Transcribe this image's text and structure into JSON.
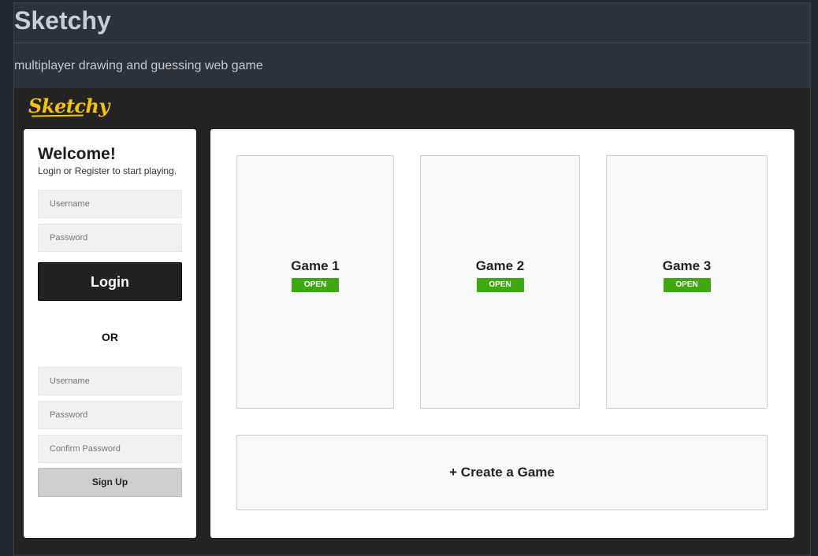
{
  "readme": {
    "title": "Sketchy",
    "description": "multiplayer drawing and guessing web game"
  },
  "app": {
    "logo_text": "Sketchy",
    "colors": {
      "accent": "#f5c400",
      "open_badge": "#3ea812",
      "dark": "#232323"
    }
  },
  "login": {
    "heading": "Welcome!",
    "subheading": "Login or Register to start playing.",
    "username_placeholder": "Username",
    "password_placeholder": "Password",
    "login_button": "Login"
  },
  "divider": "OR",
  "register": {
    "username_placeholder": "Username",
    "password_placeholder": "Password",
    "confirm_placeholder": "Confirm Password",
    "signup_button": "Sign Up"
  },
  "games": [
    {
      "title": "Game 1",
      "status": "OPEN"
    },
    {
      "title": "Game 2",
      "status": "OPEN"
    },
    {
      "title": "Game 3",
      "status": "OPEN"
    }
  ],
  "create_game_label": "+ Create a Game"
}
